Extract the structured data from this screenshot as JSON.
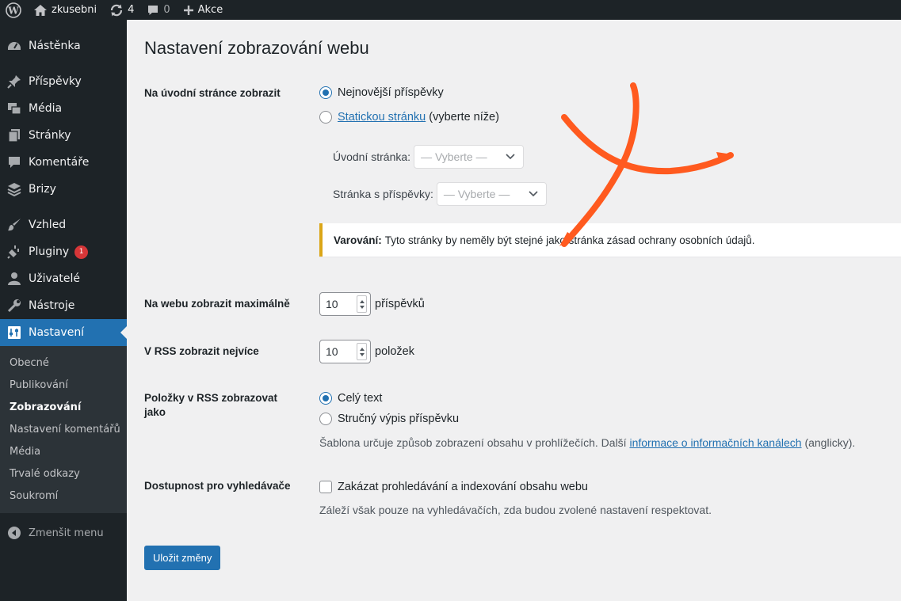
{
  "adminbar": {
    "site_name": "zkusebni",
    "updates_count": "4",
    "comments_count": "0",
    "new_label": "Akce"
  },
  "sidebar": {
    "items": [
      {
        "label": "Nástěnka",
        "icon": "dashboard-icon"
      },
      {
        "label": "Příspěvky",
        "icon": "pin-icon"
      },
      {
        "label": "Média",
        "icon": "media-icon"
      },
      {
        "label": "Stránky",
        "icon": "pages-icon"
      },
      {
        "label": "Komentáře",
        "icon": "comments-icon"
      },
      {
        "label": "Brizy",
        "icon": "brizy-icon"
      },
      {
        "label": "Vzhled",
        "icon": "appearance-icon"
      },
      {
        "label": "Pluginy",
        "icon": "plugins-icon",
        "badge": "1"
      },
      {
        "label": "Uživatelé",
        "icon": "users-icon"
      },
      {
        "label": "Nástroje",
        "icon": "tools-icon"
      },
      {
        "label": "Nastavení",
        "icon": "settings-icon"
      }
    ],
    "submenu": [
      "Obecné",
      "Publikování",
      "Zobrazování",
      "Nastavení komentářů",
      "Média",
      "Trvalé odkazy",
      "Soukromí"
    ],
    "collapse_label": "Zmenšit menu"
  },
  "page": {
    "title": "Nastavení zobrazování webu",
    "front_page": {
      "label": "Na úvodní stránce zobrazit",
      "option_latest": "Nejnovější příspěvky",
      "option_static_link": "Statickou stránku",
      "option_static_suffix": " (vyberte níže)",
      "homepage_label": "Úvodní stránka:",
      "homepage_value": "— Vyberte —",
      "postspage_label": "Stránka s příspěvky:",
      "postspage_value": "— Vyberte —"
    },
    "warning": {
      "strong": "Varování:",
      "text": "Tyto stránky by neměly být stejné jako stránka zásad ochrany osobních údajů."
    },
    "posts_per_page": {
      "label": "Na webu zobrazit maximálně",
      "value": "10",
      "unit": "příspěvků"
    },
    "rss_posts": {
      "label": "V RSS zobrazit nejvíce",
      "value": "10",
      "unit": "položek"
    },
    "rss_content": {
      "label": "Položky v RSS zobrazovat jako",
      "option_full": "Celý text",
      "option_excerpt": "Stručný výpis příspěvku",
      "description_before": "Šablona určuje způsob zobrazení obsahu v prohlížečích. Další ",
      "description_link": "informace o informačních kanálech",
      "description_after": " (anglicky)."
    },
    "search_visibility": {
      "label": "Dostupnost pro vyhledávače",
      "checkbox_label": "Zakázat prohledávání a indexování obsahu webu",
      "description": "Záleží však pouze na vyhledávačích, zda budou zvolené nastavení respektovat."
    },
    "save_button": "Uložit změny"
  },
  "colors": {
    "accent": "#2271b1",
    "sidebar_bg": "#1d2327",
    "warning_border": "#dba617",
    "scribble": "#ff5a1f"
  }
}
